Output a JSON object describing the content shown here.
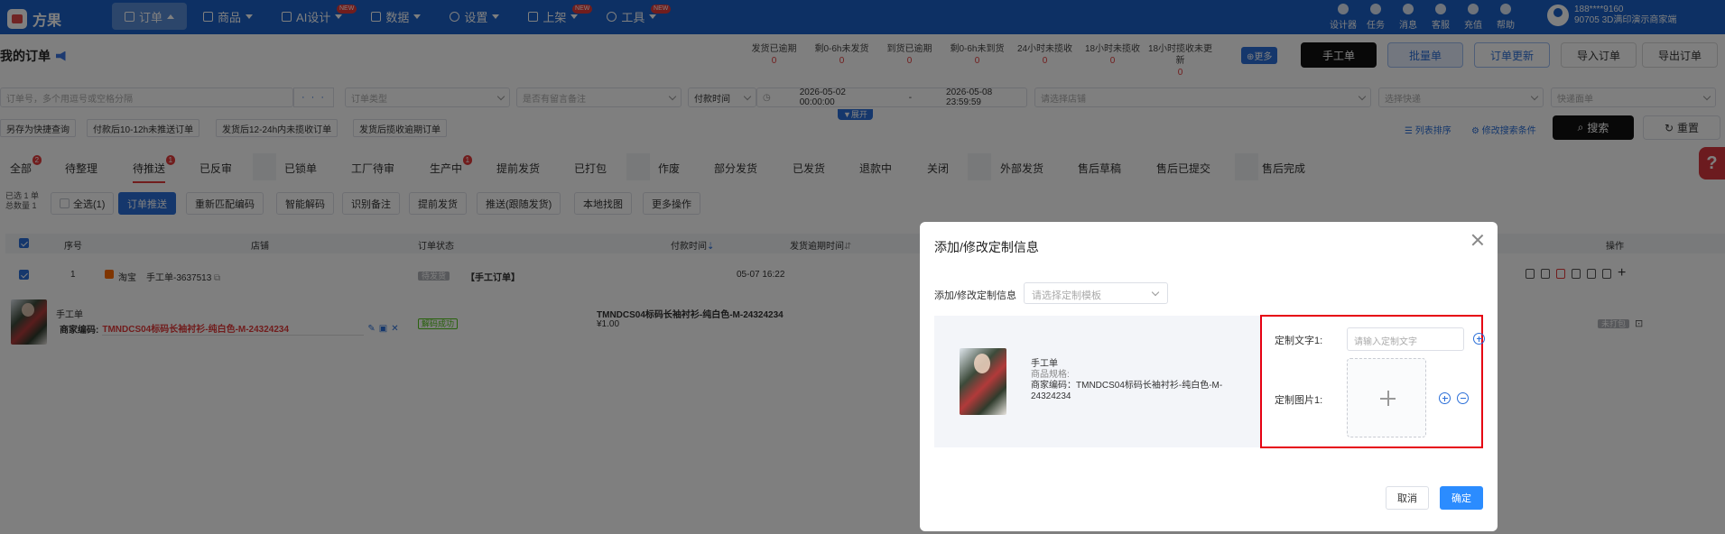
{
  "app": {
    "name": "方果"
  },
  "nav": [
    {
      "label": "订单",
      "new": false
    },
    {
      "label": "商品",
      "new": false
    },
    {
      "label": "AI设计",
      "new": true
    },
    {
      "label": "数据",
      "new": false
    },
    {
      "label": "设置",
      "new": false
    },
    {
      "label": "上架",
      "new": true
    },
    {
      "label": "工具",
      "new": true
    }
  ],
  "new_badge": "NEW",
  "tools": [
    "设计器",
    "任务",
    "消息",
    "客服",
    "充值",
    "帮助"
  ],
  "user": {
    "phone": "188****9160",
    "shop": "90705  3D满印演示商家端"
  },
  "page_title": "我的订单",
  "stats": [
    {
      "label": "发货已逾期",
      "value": "0"
    },
    {
      "label": "剩0-6h未发货",
      "value": "0"
    },
    {
      "label": "到货已逾期",
      "value": "0"
    },
    {
      "label": "剩0-6h未到货",
      "value": "0"
    },
    {
      "label": "24小时未揽收",
      "value": "0"
    },
    {
      "label": "18小时未揽收",
      "value": "0"
    },
    {
      "label": "18小时揽收未更新",
      "value": "0"
    }
  ],
  "more_label": "更多",
  "top_buttons": {
    "manual": "手工单",
    "batch": "批量单",
    "update": "订单更新",
    "import": "导入订单",
    "export": "导出订单"
  },
  "filters": {
    "order_no": "订单号，多个用逗号或空格分隔",
    "dots": "· · ·",
    "order_type": "订单类型",
    "remark": "是否有留言备注",
    "pay_time": "付款时间",
    "date_start": "2026-05-02 00:00:00",
    "date_sep": "-",
    "date_end": "2026-05-08 23:59:59",
    "shop": "请选择店铺",
    "express": "选择快递",
    "waybill": "快递面单"
  },
  "expand_label": "展开",
  "quick": [
    "另存为快捷查询",
    "付款后10-12h未推送订单",
    "发货后12-24h内未揽收订单",
    "发货后揽收逾期订单"
  ],
  "links": {
    "sort": "列表排序",
    "modify": "修改搜索条件"
  },
  "search_label": "搜索",
  "reset_label": "重置",
  "tabs": [
    {
      "label": "全部",
      "badge": "2"
    },
    {
      "label": "待整理",
      "badge": ""
    },
    {
      "label": "待推送",
      "badge": "1"
    },
    {
      "label": "已反审",
      "badge": ""
    },
    {
      "label": "已锁单",
      "badge": ""
    },
    {
      "label": "工厂待审",
      "badge": ""
    },
    {
      "label": "生产中",
      "badge": "1"
    },
    {
      "label": "提前发货",
      "badge": ""
    },
    {
      "label": "已打包",
      "badge": ""
    },
    {
      "label": "作废",
      "badge": ""
    },
    {
      "label": "部分发货",
      "badge": ""
    },
    {
      "label": "已发货",
      "badge": ""
    },
    {
      "label": "退款中",
      "badge": ""
    },
    {
      "label": "关闭",
      "badge": ""
    },
    {
      "label": "外部发货",
      "badge": ""
    },
    {
      "label": "售后草稿",
      "badge": ""
    },
    {
      "label": "售后已提交",
      "badge": ""
    },
    {
      "label": "售后完成",
      "badge": ""
    }
  ],
  "selection": {
    "selected": "已选 1 单",
    "total": "总数量 1"
  },
  "actions": [
    "全选(1)",
    "订单推送",
    "重新匹配编码",
    "智能解码",
    "识别备注",
    "提前发货",
    "推送(跟随发货)",
    "本地找图",
    "更多操作"
  ],
  "table": {
    "headers": {
      "no": "序号",
      "shop": "店铺",
      "status": "订单状态",
      "pay_time": "付款时间",
      "deadline": "发货逾期时间",
      "ops": "操作"
    },
    "row": {
      "no": "1",
      "platform": "淘宝",
      "order": "手工单-3637513",
      "status": "待发货",
      "tag": "【手工订单】",
      "pay": "05-07 16:22"
    },
    "product": {
      "name": "手工单",
      "code_label": "商家编码:",
      "code": "TMNDCS04标码长袖衬衫-纯白色-M-24324234",
      "decode": "解码成功",
      "title": "TMNDCS04标码长袖衬衫-纯白色-M-24324234",
      "price": "¥1.00",
      "pack": "未打包"
    }
  },
  "modal": {
    "title": "添加/修改定制信息",
    "label": "添加/修改定制信息",
    "template_placeholder": "请选择定制模板",
    "product_name": "手工单",
    "spec": "商品规格:",
    "code": "商家编码：TMNDCS04标码长袖衬衫-纯白色-M-24324234",
    "text_label": "定制文字1:",
    "text_placeholder": "请输入定制文字",
    "image_label": "定制图片1:",
    "cancel": "取消",
    "confirm": "确定"
  },
  "colors": {
    "brand": "#1a61c8",
    "primary": "#2b6fd8",
    "danger": "#e23b3b",
    "highlight": "#e60012"
  }
}
